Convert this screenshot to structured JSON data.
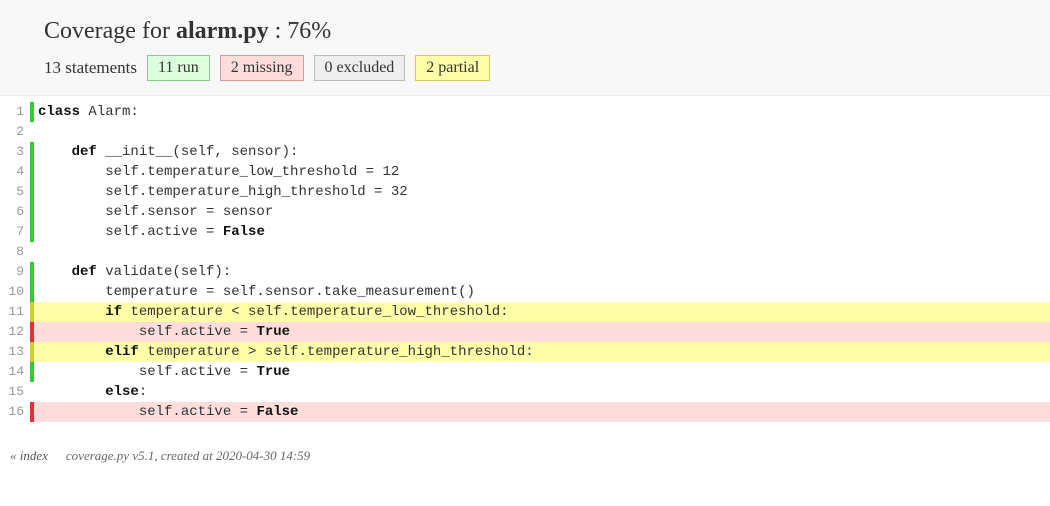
{
  "header": {
    "prefix": "Coverage for ",
    "filename": "alarm.py",
    "sep": " : ",
    "percent": "76%",
    "statements_label": "13 statements",
    "badges": {
      "run": "11 run",
      "missing": "2 missing",
      "excluded": "0 excluded",
      "partial": "2 partial"
    }
  },
  "lines": [
    {
      "n": "1",
      "status": "run",
      "tokens": [
        {
          "t": "class ",
          "c": "kw"
        },
        {
          "t": "Alarm:",
          "c": ""
        }
      ]
    },
    {
      "n": "2",
      "status": "none",
      "tokens": []
    },
    {
      "n": "3",
      "status": "run",
      "tokens": [
        {
          "t": "    ",
          "c": ""
        },
        {
          "t": "def ",
          "c": "kw"
        },
        {
          "t": "__init__(self, sensor):",
          "c": ""
        }
      ]
    },
    {
      "n": "4",
      "status": "run",
      "tokens": [
        {
          "t": "        self.temperature_low_threshold = 12",
          "c": ""
        }
      ]
    },
    {
      "n": "5",
      "status": "run",
      "tokens": [
        {
          "t": "        self.temperature_high_threshold = 32",
          "c": ""
        }
      ]
    },
    {
      "n": "6",
      "status": "run",
      "tokens": [
        {
          "t": "        self.sensor = sensor",
          "c": ""
        }
      ]
    },
    {
      "n": "7",
      "status": "run",
      "tokens": [
        {
          "t": "        self.active = ",
          "c": ""
        },
        {
          "t": "False",
          "c": "bold"
        }
      ]
    },
    {
      "n": "8",
      "status": "none",
      "tokens": []
    },
    {
      "n": "9",
      "status": "run",
      "tokens": [
        {
          "t": "    ",
          "c": ""
        },
        {
          "t": "def ",
          "c": "kw"
        },
        {
          "t": "validate(self):",
          "c": ""
        }
      ]
    },
    {
      "n": "10",
      "status": "run",
      "tokens": [
        {
          "t": "        temperature = self.sensor.take_measurement()",
          "c": ""
        }
      ]
    },
    {
      "n": "11",
      "status": "partial",
      "tokens": [
        {
          "t": "        ",
          "c": ""
        },
        {
          "t": "if ",
          "c": "kw"
        },
        {
          "t": "temperature < self.temperature_low_threshold:",
          "c": ""
        }
      ]
    },
    {
      "n": "12",
      "status": "missing",
      "tokens": [
        {
          "t": "            self.active = ",
          "c": ""
        },
        {
          "t": "True",
          "c": "bold"
        }
      ]
    },
    {
      "n": "13",
      "status": "partial",
      "tokens": [
        {
          "t": "        ",
          "c": ""
        },
        {
          "t": "elif ",
          "c": "kw"
        },
        {
          "t": "temperature > self.temperature_high_threshold:",
          "c": ""
        }
      ]
    },
    {
      "n": "14",
      "status": "run",
      "tokens": [
        {
          "t": "            self.active = ",
          "c": ""
        },
        {
          "t": "True",
          "c": "bold"
        }
      ]
    },
    {
      "n": "15",
      "status": "none",
      "tokens": [
        {
          "t": "        ",
          "c": ""
        },
        {
          "t": "else",
          "c": "kw"
        },
        {
          "t": ":",
          "c": ""
        }
      ]
    },
    {
      "n": "16",
      "status": "missing",
      "tokens": [
        {
          "t": "            self.active = ",
          "c": ""
        },
        {
          "t": "False",
          "c": "bold"
        }
      ]
    }
  ],
  "footer": {
    "index": "« index",
    "info": "coverage.py v5.1, created at 2020-04-30 14:59"
  }
}
